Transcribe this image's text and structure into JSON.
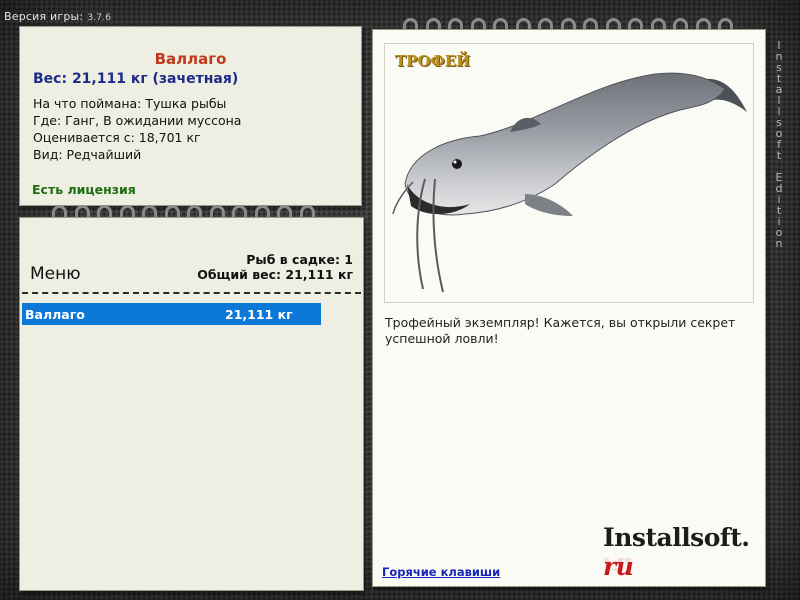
{
  "version": {
    "label": "Версия игры:",
    "number": "3.7.6"
  },
  "fish_info": {
    "name": "Валлаго",
    "weight_line": "Вес: 21,111 кг (зачетная)",
    "bait": "На что поймана: Тушка рыбы",
    "location": "Где: Ганг, В ожидании муссона",
    "value": "Оценивается с: 18,701 кг",
    "type": "Вид: Редчайший",
    "license": "Есть лицензия"
  },
  "menu": {
    "title": "Меню",
    "fish_count": "Рыб в садке: 1",
    "total_weight": "Общий вес: 21,111 кг",
    "items": [
      {
        "name": "Валлаго",
        "weight": "21,111 кг",
        "selected": true
      }
    ]
  },
  "trophy": {
    "label": "ТРОФЕЙ",
    "description": "Трофейный экземпляр! Кажется, вы открыли секрет успешной ловли!",
    "hotkeys": "Горячие клавиши"
  },
  "logo": {
    "main": "Installsoft.",
    "suffix": "ru"
  },
  "watermark": "Installsoft Edition",
  "colors": {
    "fish_name": "#c0391b",
    "weight": "#1d2b8a",
    "license": "#1d6e10",
    "selection": "#0c79d8",
    "trophy_label": "#b9901e",
    "link": "#1626b8",
    "logo_suffix": "#c81c1c"
  }
}
